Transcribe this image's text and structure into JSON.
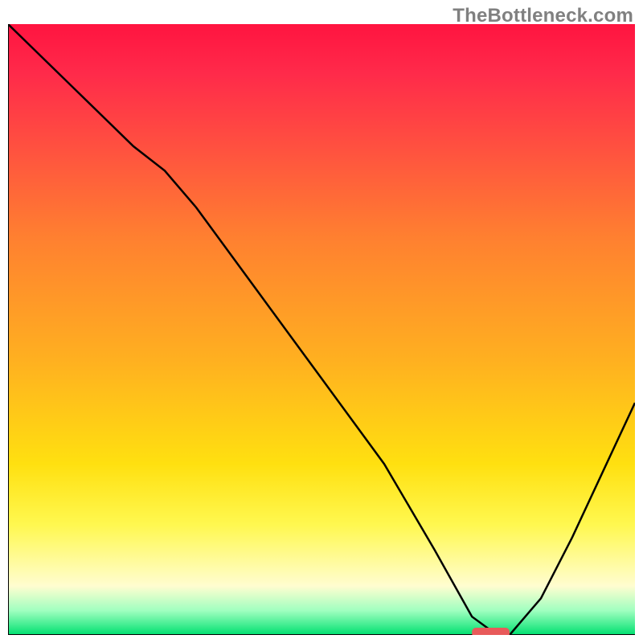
{
  "watermark": "TheBottleneck.com",
  "chart_data": {
    "type": "line",
    "title": "",
    "xlabel": "",
    "ylabel": "",
    "xlim": [
      0,
      100
    ],
    "ylim": [
      0,
      100
    ],
    "grid": false,
    "legend": false,
    "series": [
      {
        "name": "bottleneck-curve",
        "x": [
          0,
          10,
          20,
          25,
          30,
          40,
          50,
          60,
          68,
          74,
          78,
          80,
          85,
          90,
          100
        ],
        "y": [
          100,
          90,
          80,
          76,
          70,
          56,
          42,
          28,
          14,
          3,
          0,
          0,
          6,
          16,
          38
        ]
      }
    ],
    "marker": {
      "name": "optimal-range",
      "x_start": 74,
      "x_end": 80,
      "y": 0
    },
    "background_gradient": {
      "stops": [
        {
          "pos": 0.0,
          "color": "#ff1440"
        },
        {
          "pos": 0.08,
          "color": "#ff2a4a"
        },
        {
          "pos": 0.2,
          "color": "#ff5040"
        },
        {
          "pos": 0.35,
          "color": "#ff8030"
        },
        {
          "pos": 0.55,
          "color": "#ffb020"
        },
        {
          "pos": 0.72,
          "color": "#ffe010"
        },
        {
          "pos": 0.82,
          "color": "#fff850"
        },
        {
          "pos": 0.92,
          "color": "#fffdd0"
        },
        {
          "pos": 0.96,
          "color": "#a0ffc0"
        },
        {
          "pos": 1.0,
          "color": "#00e070"
        }
      ]
    }
  }
}
